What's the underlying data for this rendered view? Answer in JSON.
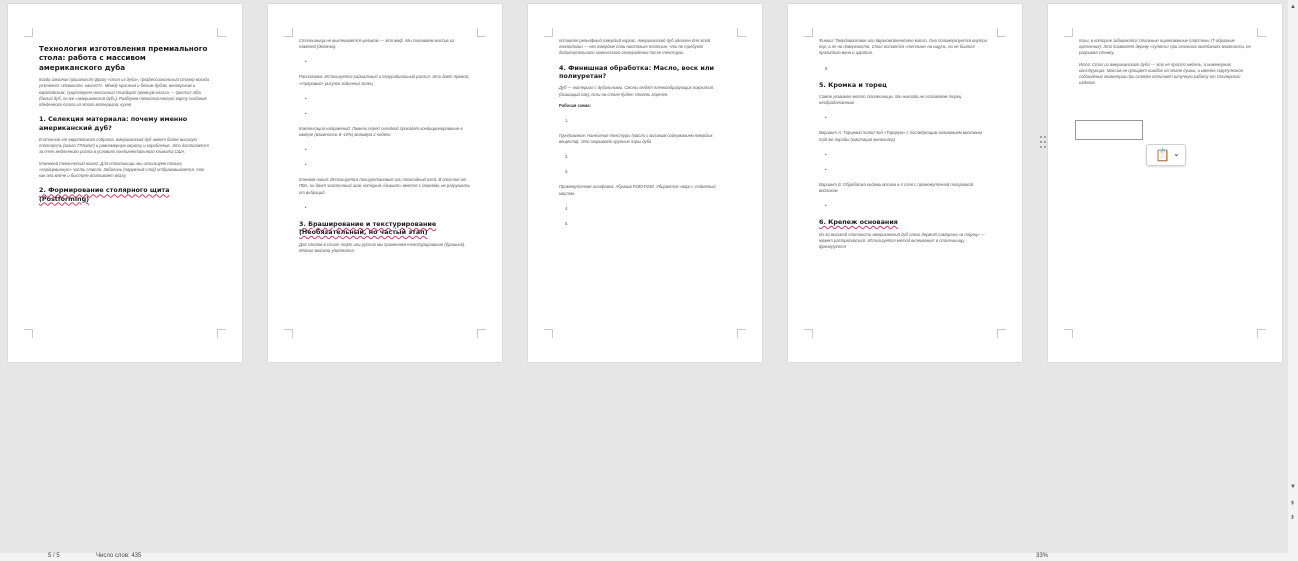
{
  "pages": [
    {
      "title": "Технология изготовления премиального стола: работа с массивом американского дуба",
      "intro": "Когда заказчик произносит фразу «стол из дуба», профессиональный столяр всегда уточняет «Извините, какого?». Между красным и белым дубом, венгерским и европейским, существует негласный стандарт премиум-класса — Quercus Alba (белый дуб, он же «американский дуб»). Разберем технологическую карту создания обеденного стола из этого материала: кухня",
      "h_1": "1. Селекция материала: почему именно американский дуб?",
      "p_1": "В отличие от европейского собрата, американский дуб имеет более высокую плотность (около 770кг/м³) и равномерную окраску и коробление. Это достигается за счет медленного роста в условиях континентального климата США.",
      "p_2": "Ключевой технический нюанс: Для столешницы мы используем только «сердцевинную» часть ствола. Заболонь (наружный слой) отбраковывается, так как она мягче и быстрее впитывает влагу.",
      "h_2": "2. Формирование столярного щита (Postforming)"
    },
    {
      "p_top": "Столешница не выклеивается целиком — это миф. Мы склеиваем массив из ламелей (делянок).",
      "p_1": "Распиловка: Используется радиальный и полурадиальный распил. Это дает прямой, «тигровый» рисунок годичных колец",
      "p_2": "Компенсация напряжений: Ламели перед склейкой проходят кондиционирование в камере (влажность 8–10%) минимум 2 недели",
      "p_3": "Клеевая линия: Используется полиуретановый или эпоксидный клей. В отличие от ПВА, он дает эластичный шов, который «дышит» вместе с деревом, не разрушаясь от вибраций",
      "h_1": "3. Браширование и текстурирование (Необязательный, но частый этап)",
      "p_4": "Для столов в стиле лофт или рустик мы применяем текстурирование (брашинг). Мягкие волокна удаляются,"
    },
    {
      "p_top": "оставляя рельефный твердый каркас. Американский дуб идеален для этой технологии — его твердые слои настолько плотные, что не требуют дополнительного химического отверждения после текстуры.",
      "h_1": "4. Финишная обработка: Масло, воск или полиуретан?",
      "p_1": "Дуб — материал с дубильными. Смолы любят пленкообразующих покрытий (дышащий лак), если на столе будет стоять горячее.",
      "p_2": "Рабочая схема:",
      "p_3": "Грунтование: Нанесение текстуры (масло с высоким содержанием твердых веществ). Это закрывает крупные поры дуба",
      "p_4": "Промежуточная шлифовка: Абразив P180-P240. Убирается «ворс», поднятый маслом"
    },
    {
      "p_top": "Финиш: Твердовосковое или двухкомпонентное масло. Оно полимеризуется внутри пор, а не на поверхности. Стол остается «теплым» на ощупь, но не боится пролитого вина и царапин.",
      "h_1": "5. Кромка и торец",
      "p_1": "Самое уязвимое место столешницы. Мы никогда не оставляем торец необработанным",
      "p_2": "Вариант А: Торцевой пилой под «Торцеую» с последующим заливанием восковым той же породы (имитация монолита)",
      "p_3": "Вариант Б: Обработка кидами воском в 4 слоя с промежуточной полировкой войлоком",
      "h_2": "6. Крепеж основания",
      "p_4": "Из-за высокой плотности американский дуб плохо держит саморезы «в торец» — может растрескаться. Используется метод вклеивания: в столешницу фрезеруется"
    },
    {
      "p_top": "пазы, в которые забиваются стальные оцинкованные пластины (Т-образные крепления). Это позволяет дереву «гулять» при сезонных колебаниях влажности, не разрывая стежку.",
      "p_1": "Итог: Стол из американского дуба — это не просто мебель, а инженерная конструкция. Массив не прощает ошибок на этапе сушки, и именно скрупулезное соблюдение геометрии при склейке отличает штучную работу от столярного изделия."
    }
  ],
  "status_bar": {
    "page_info": "5 / 5",
    "words": "Число слов: 435",
    "zoom": "33%"
  }
}
